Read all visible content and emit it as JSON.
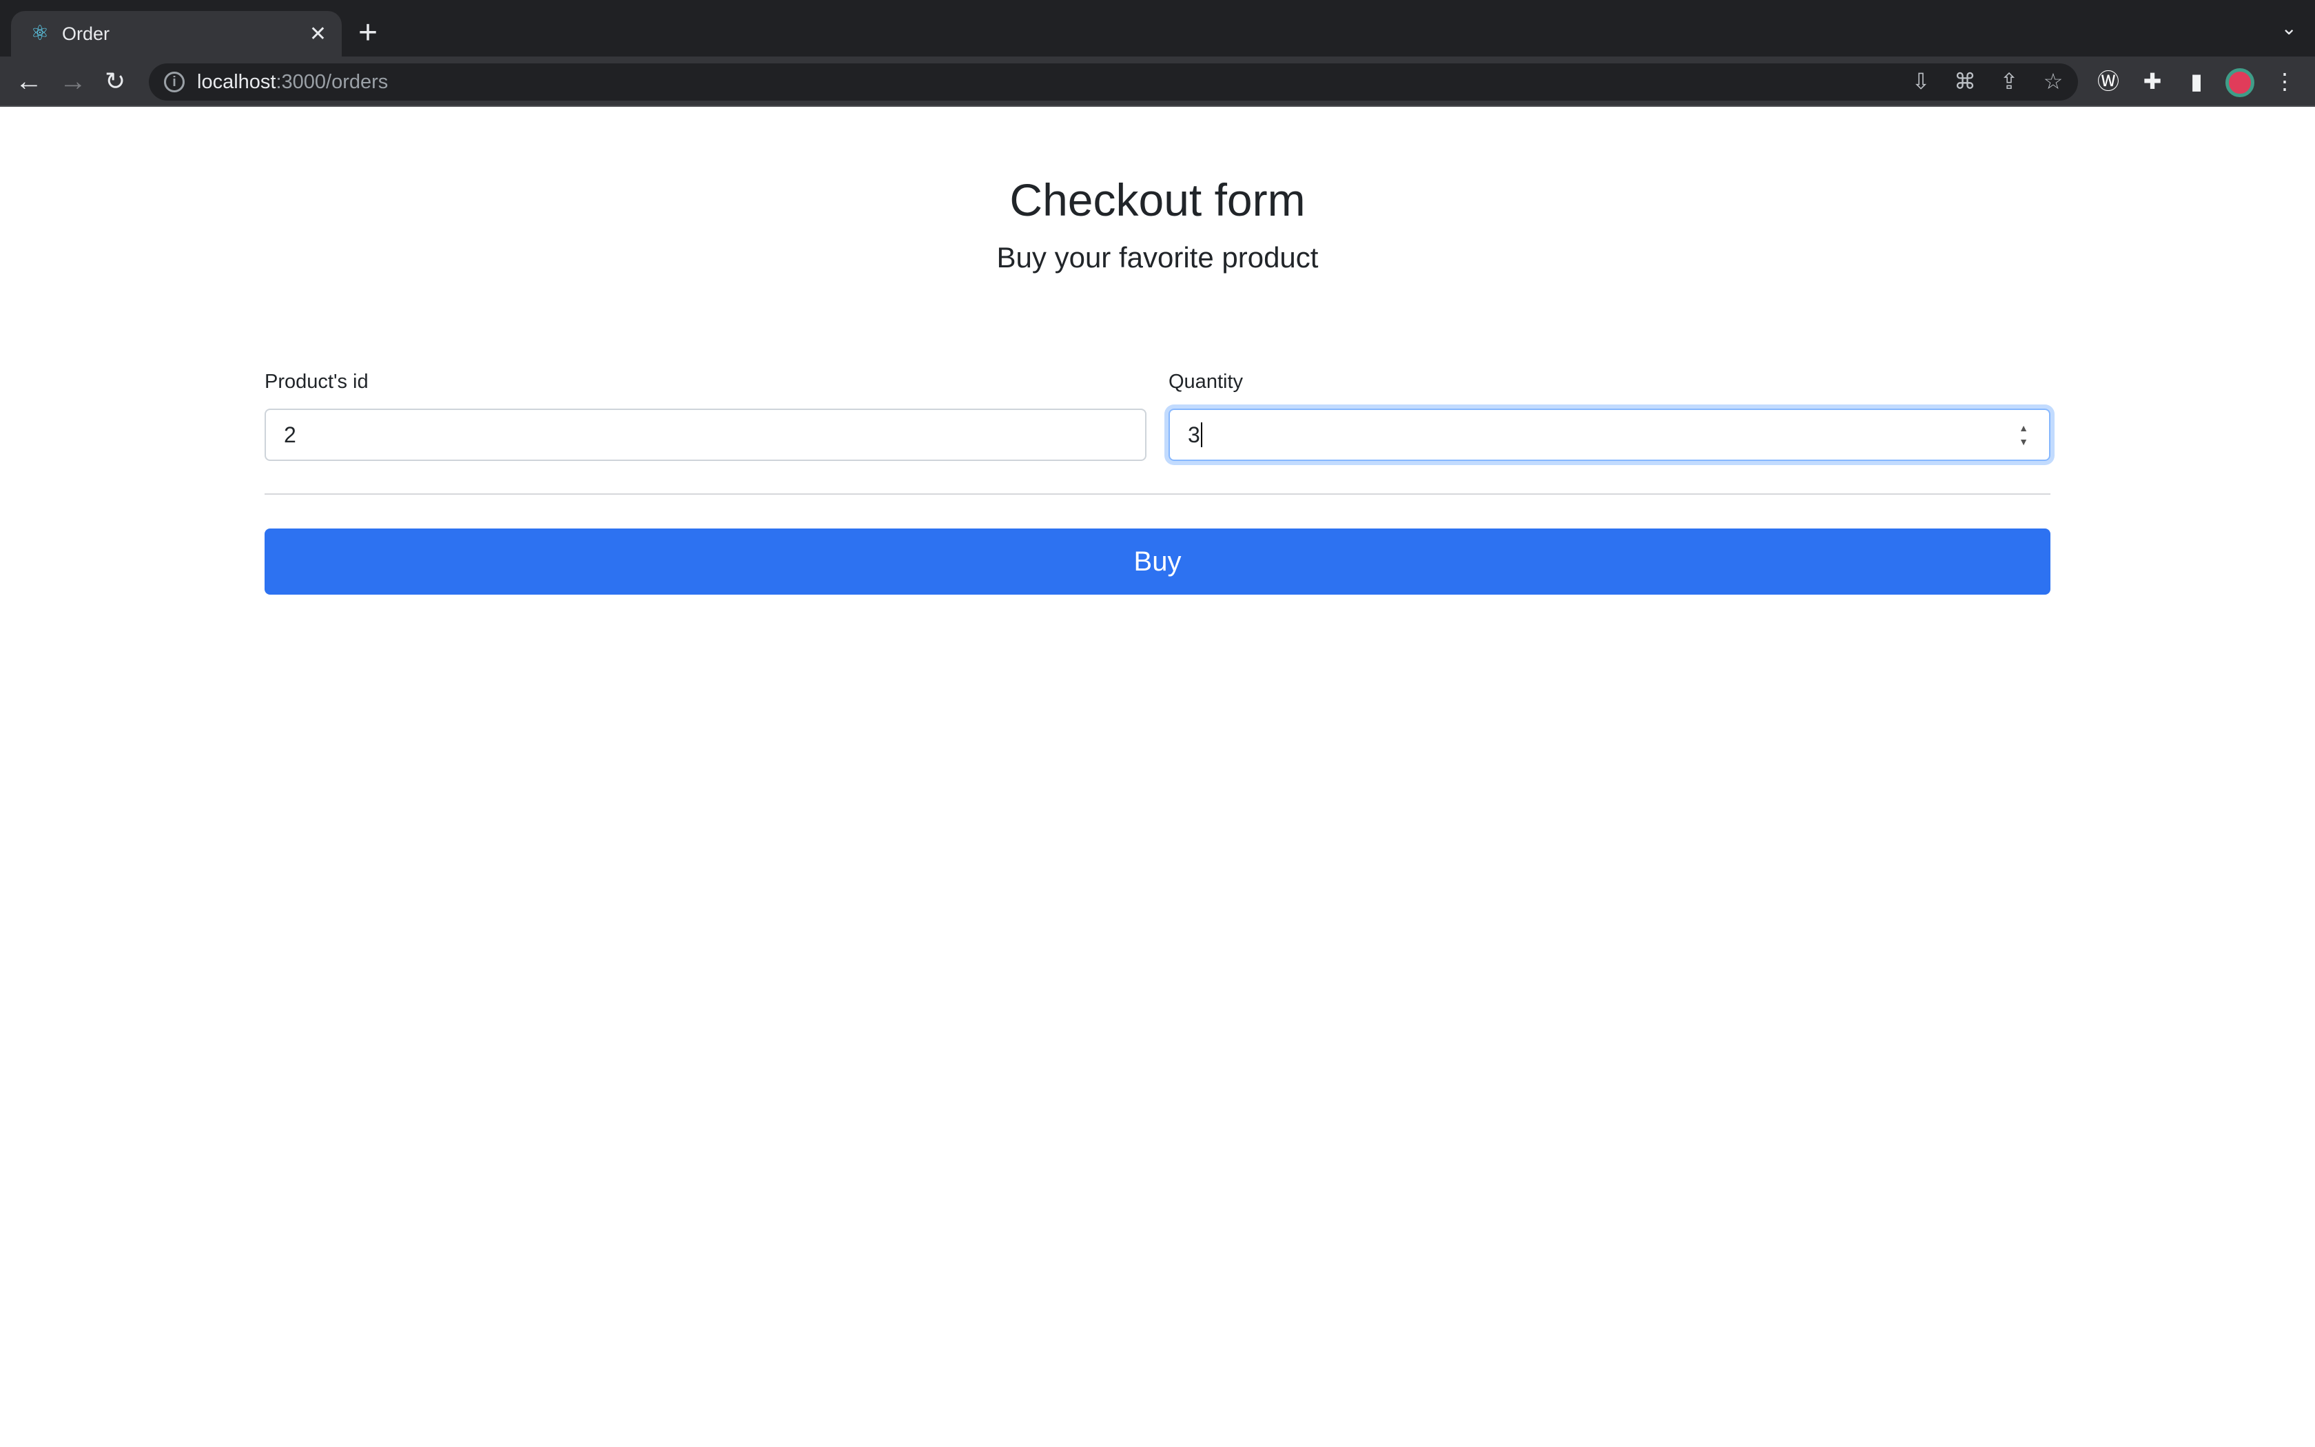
{
  "browser": {
    "tab_title": "Order",
    "url_host": "localhost",
    "url_path": ":3000/orders"
  },
  "page": {
    "title": "Checkout form",
    "subtitle": "Buy your favorite product",
    "product_id_label": "Product's id",
    "product_id_value": "2",
    "quantity_label": "Quantity",
    "quantity_value": "3",
    "buy_label": "Buy"
  },
  "colors": {
    "accent": "#2d72f1"
  }
}
